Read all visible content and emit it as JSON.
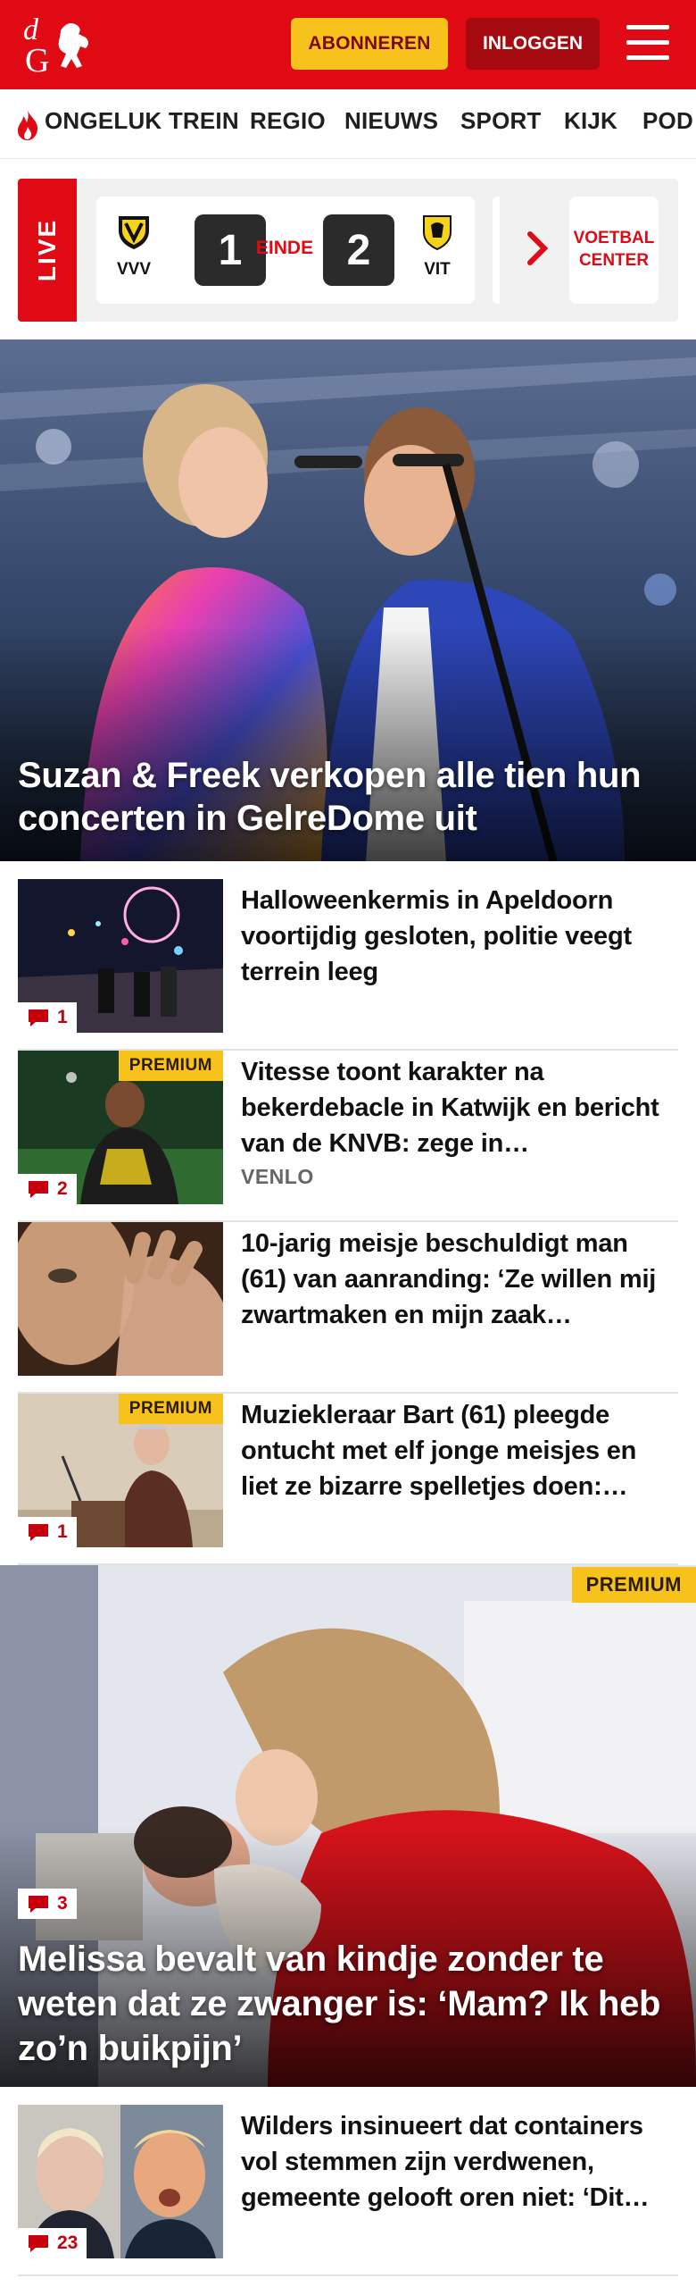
{
  "header": {
    "subscribe_label": "ABONNEREN",
    "login_label": "INLOGGEN",
    "brand_color": "#e00a14"
  },
  "nav": {
    "items": [
      "ONGELUK TREIN",
      "REGIO",
      "NIEUWS",
      "SPORT",
      "KIJK",
      "POD"
    ]
  },
  "live": {
    "label": "LIVE",
    "home_team": "VVV",
    "away_team": "VIT",
    "home_crest_text": "VVV VENLO",
    "home_score": "1",
    "away_score": "2",
    "status": "EINDE",
    "center_label": "VOETBAL CENTER"
  },
  "hero": {
    "title": "Suzan & Freek verkopen alle tien hun concerten in GelreDome uit"
  },
  "articles": [
    {
      "title": "Halloweenkermis in Apeldoorn voortijdig gesloten, politie veegt terrein leeg",
      "comments": "1"
    },
    {
      "title": "Vitesse toont karakter na bekerdebacle in Katwijk en bericht van de KNVB: zege in…",
      "comments": "2",
      "premium": "PREMIUM",
      "tag": "VENLO"
    },
    {
      "title": "10-jarig meisje beschuldigt man (61) van aanranding: ‘Ze willen mij zwartmaken en mijn zaak…"
    },
    {
      "title": "Muziekleraar Bart (61) pleegde ontucht met elf jonge meisjes en liet ze bizarre spelletjes doen:…",
      "comments": "1",
      "premium": "PREMIUM"
    }
  ],
  "story2": {
    "title": "Melissa bevalt van kindje zonder te weten dat ze zwanger is: ‘Mam? Ik heb zo’n buikpijn’",
    "comments": "3",
    "premium": "PREMIUM"
  },
  "articles2": [
    {
      "title": "Wilders insinueert dat containers vol stemmen zijn verdwenen, gemeente gelooft oren niet: ‘Dit…",
      "comments": "23"
    }
  ]
}
